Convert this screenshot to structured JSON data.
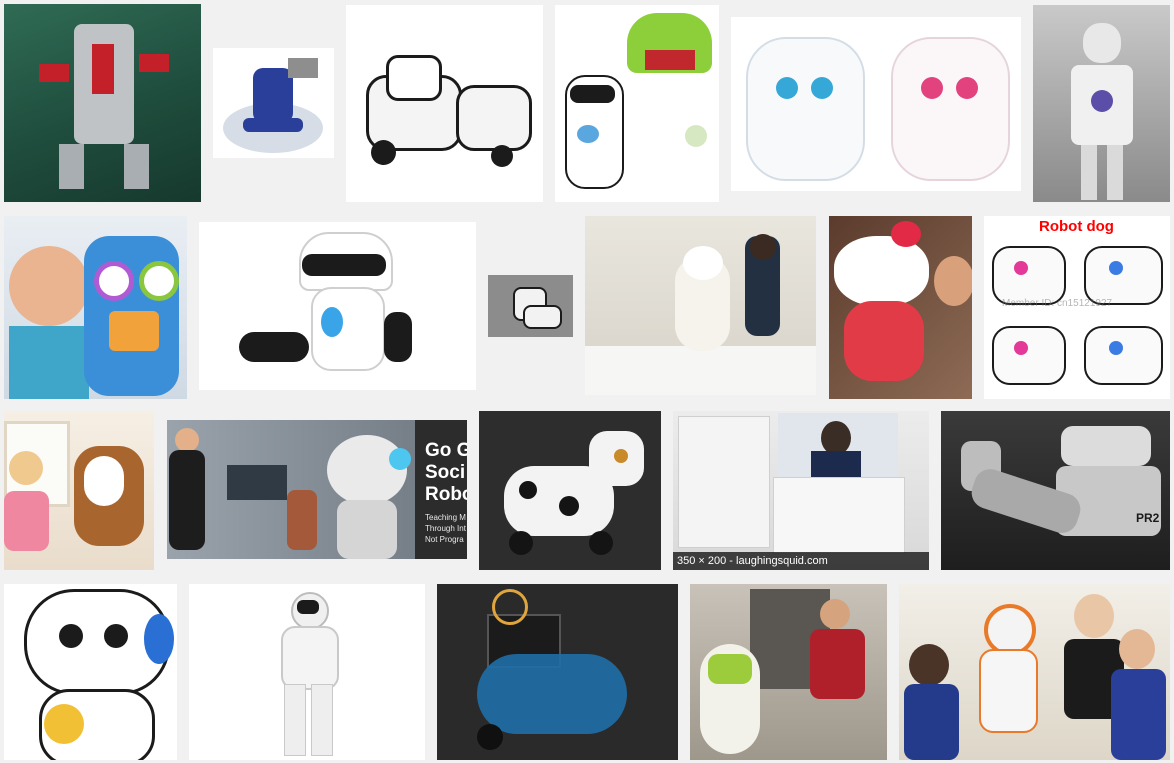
{
  "images": [
    {
      "name": "robot-kit-photo",
      "alt": ""
    },
    {
      "name": "blue-robot-render",
      "alt": ""
    },
    {
      "name": "robot-dogs-photo",
      "alt": ""
    },
    {
      "name": "dino-and-mip-photo",
      "alt": ""
    },
    {
      "name": "robot-puppies-photo",
      "alt": ""
    },
    {
      "name": "humanoid-robot-photo",
      "alt": ""
    },
    {
      "name": "kid-with-toy-robot-photo",
      "alt": ""
    },
    {
      "name": "mip-robot-photo",
      "alt": ""
    },
    {
      "name": "small-robot-dog-photo",
      "alt": ""
    },
    {
      "name": "care-robot-photo",
      "alt": ""
    },
    {
      "name": "hello-kitty-robot-photo",
      "alt": ""
    },
    {
      "name": "robot-dog-ad-photo",
      "alt": ""
    },
    {
      "name": "girl-with-robot-dog-photo",
      "alt": ""
    },
    {
      "name": "social-robot-photo",
      "alt": ""
    },
    {
      "name": "spotted-robot-dog-photo",
      "alt": ""
    },
    {
      "name": "kiosk-telepresence-photo",
      "alt": ""
    },
    {
      "name": "pr2-robot-photo",
      "alt": ""
    },
    {
      "name": "white-toy-robot-photo",
      "alt": ""
    },
    {
      "name": "asimo-robot-photo",
      "alt": ""
    },
    {
      "name": "blue-wheeled-bot-photo",
      "alt": ""
    },
    {
      "name": "kameri-robot-photo",
      "alt": ""
    },
    {
      "name": "classroom-nao-photo",
      "alt": ""
    }
  ],
  "overlays": {
    "robot_dog_label": "Robot dog",
    "robot_dog_watermark": "Member ID: cn15121927",
    "social_sign_title": "Go G\nSoci\nRobo",
    "social_sign_sub": "Teaching M\nThrough Int\nNot Progra",
    "kiosk_caption": "350 × 200 - laughingsquid.com",
    "pr2_label": "PR2"
  },
  "colors": {
    "page_background": "#f1f1f1",
    "overlay_red": "#ff0000"
  }
}
